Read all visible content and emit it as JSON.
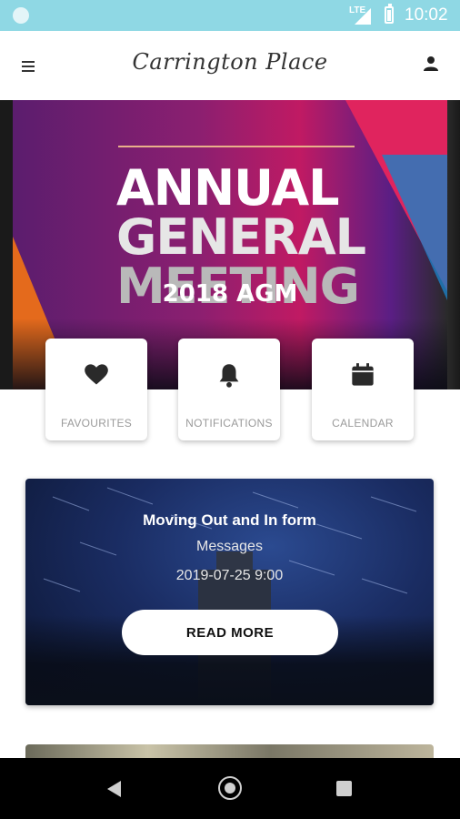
{
  "status_bar": {
    "network": "LTE",
    "time": "10:02"
  },
  "header": {
    "brand": "Carrington Place"
  },
  "hero": {
    "title_lines": [
      "ANNUAL",
      "GENERAL",
      "MEETING"
    ],
    "subtitle": "2018 AGM"
  },
  "quick_links": [
    {
      "label": "FAVOURITES",
      "icon": "heart-icon"
    },
    {
      "label": "NOTIFICATIONS",
      "icon": "bell-icon"
    },
    {
      "label": "CALENDAR",
      "icon": "calendar-icon"
    }
  ],
  "posts": [
    {
      "title": "Moving Out and In form",
      "category": "Messages",
      "date": "2019-07-25 9:00",
      "button_label": "READ MORE"
    }
  ],
  "colors": {
    "status_bar": "#8fd8e4",
    "header_bg": "#ffffff",
    "tile_label": "#9a9a9a",
    "nav_bar": "#000000"
  }
}
